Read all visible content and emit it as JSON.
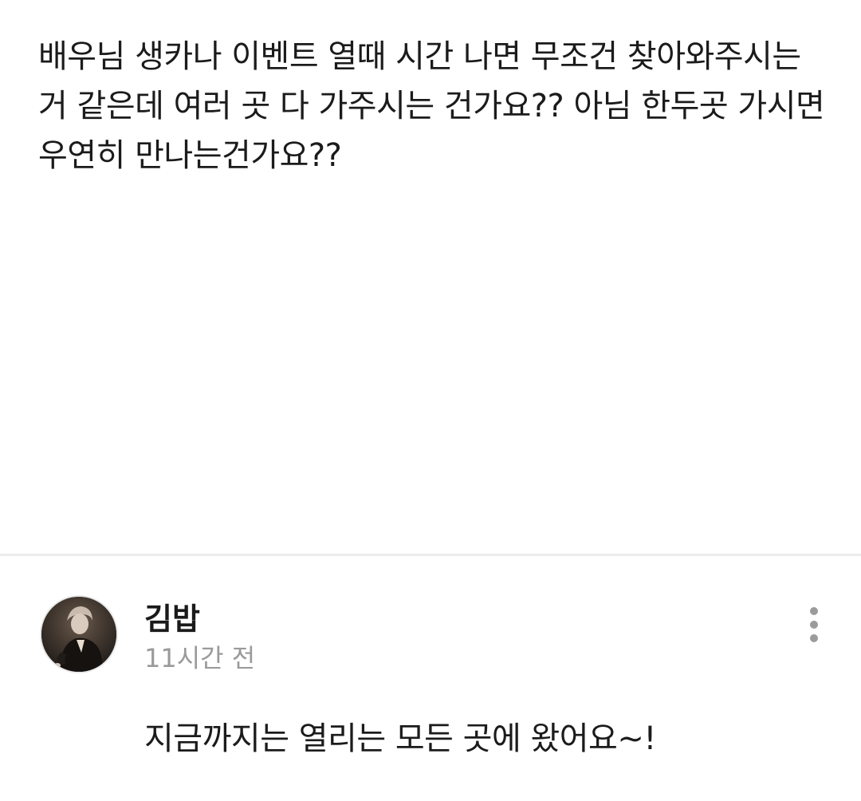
{
  "post": {
    "body": "배우님 생카나 이벤트 열때 시간 나면 무조건 찾아와주시는 거 같은데 여러 곳 다 가주시는 건가요?? 아님 한두곳 가시면 우연히 만나는건가요??"
  },
  "comment": {
    "author": "김밥",
    "timestamp": "11시간 전",
    "text": "지금까지는 열리는 모든 곳에 왔어요~!",
    "avatar_icon": "profile-photo-icon",
    "more_icon": "more-vertical-icon"
  },
  "colors": {
    "text": "#1b1b1b",
    "muted": "#9a9a9a",
    "divider": "#ececec",
    "background": "#ffffff"
  }
}
